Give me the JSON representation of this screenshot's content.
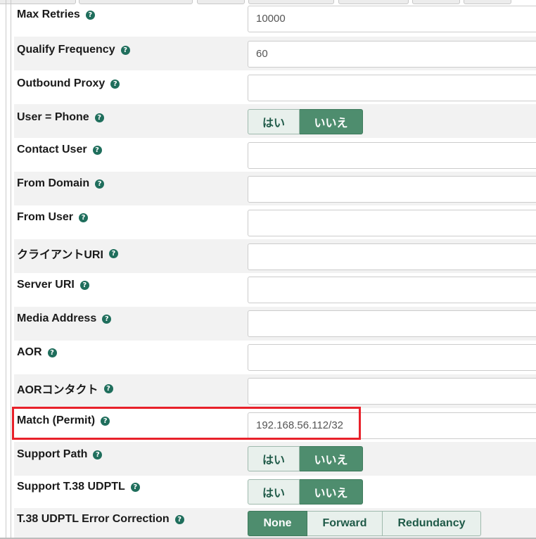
{
  "form": {
    "rows": [
      {
        "label": "Max Retries",
        "type": "input",
        "value": "10000"
      },
      {
        "label": "Qualify Frequency",
        "type": "input",
        "value": "60"
      },
      {
        "label": "Outbound Proxy",
        "type": "input",
        "value": ""
      },
      {
        "label": "User = Phone",
        "type": "toggle",
        "options": [
          "はい",
          "いいえ"
        ],
        "selected": "いいえ"
      },
      {
        "label": "Contact User",
        "type": "input",
        "value": ""
      },
      {
        "label": "From Domain",
        "type": "input",
        "value": ""
      },
      {
        "label": "From User",
        "type": "input",
        "value": ""
      },
      {
        "label": "クライアントURI",
        "type": "input",
        "value": ""
      },
      {
        "label": "Server URI",
        "type": "input",
        "value": ""
      },
      {
        "label": "Media Address",
        "type": "input",
        "value": ""
      },
      {
        "label": "AOR",
        "type": "input",
        "value": ""
      },
      {
        "label": "AORコンタクト",
        "type": "input",
        "value": ""
      },
      {
        "label": "Match (Permit)",
        "type": "input",
        "value": "192.168.56.112/32"
      },
      {
        "label": "Support Path",
        "type": "toggle",
        "options": [
          "はい",
          "いいえ"
        ],
        "selected": "いいえ"
      },
      {
        "label": "Support T.38 UDPTL",
        "type": "toggle",
        "options": [
          "はい",
          "いいえ"
        ],
        "selected": "いいえ"
      },
      {
        "label": "T.38 UDPTL Error Correction",
        "type": "toggle3",
        "options": [
          "None",
          "Forward",
          "Redundancy"
        ],
        "selected": "None"
      }
    ]
  },
  "colors": {
    "accent": "#4e8d6e",
    "help_icon": "#1f6e5c",
    "highlight": "#e8212a"
  },
  "icons": {
    "help": "question-circle-icon"
  }
}
